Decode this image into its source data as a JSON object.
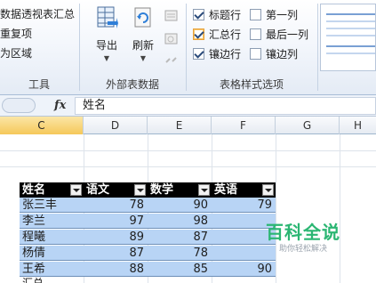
{
  "ribbon": {
    "tools_group": {
      "items": [
        "数据透视表汇总",
        "重复项",
        "为区域"
      ],
      "label": "工具"
    },
    "external_group": {
      "export_label": "导出",
      "refresh_label": "刷新",
      "label": "外部表数据"
    },
    "style_options_group": {
      "options": [
        {
          "label": "标题行",
          "checked": true
        },
        {
          "label": "第一列",
          "checked": false
        },
        {
          "label": "汇总行",
          "checked": true
        },
        {
          "label": "最后一列",
          "checked": false
        },
        {
          "label": "镶边行",
          "checked": true
        },
        {
          "label": "镶边列",
          "checked": false
        }
      ],
      "label": "表格样式选项"
    }
  },
  "formula_bar": {
    "fx": "fx",
    "value": "姓名"
  },
  "sheet": {
    "columns": [
      {
        "label": "C",
        "selected": true
      },
      {
        "label": "D",
        "selected": false
      },
      {
        "label": "E",
        "selected": false
      },
      {
        "label": "F",
        "selected": false
      },
      {
        "label": "G",
        "selected": false
      },
      {
        "label": "H",
        "selected": false
      }
    ],
    "table": {
      "headers": [
        "姓名",
        "语文",
        "数学",
        "英语"
      ],
      "rows": [
        {
          "name": "张三丰",
          "chinese": "78",
          "math": "90",
          "english": "79"
        },
        {
          "name": "李兰",
          "chinese": "97",
          "math": "98",
          "english": ""
        },
        {
          "name": "程曦",
          "chinese": "89",
          "math": "87",
          "english": ""
        },
        {
          "name": "杨倩",
          "chinese": "87",
          "math": "78",
          "english": ""
        },
        {
          "name": "王希",
          "chinese": "88",
          "math": "85",
          "english": "90"
        }
      ],
      "partial_row_label": "汇总"
    }
  },
  "watermark": {
    "title": "百科全说",
    "subtitle": "助你轻松解决"
  },
  "colors": {
    "header_fill": "#000000",
    "row_fill": "#b8d4f5",
    "selected_column": "#f5c85a",
    "watermark_green": "#2bb673"
  }
}
